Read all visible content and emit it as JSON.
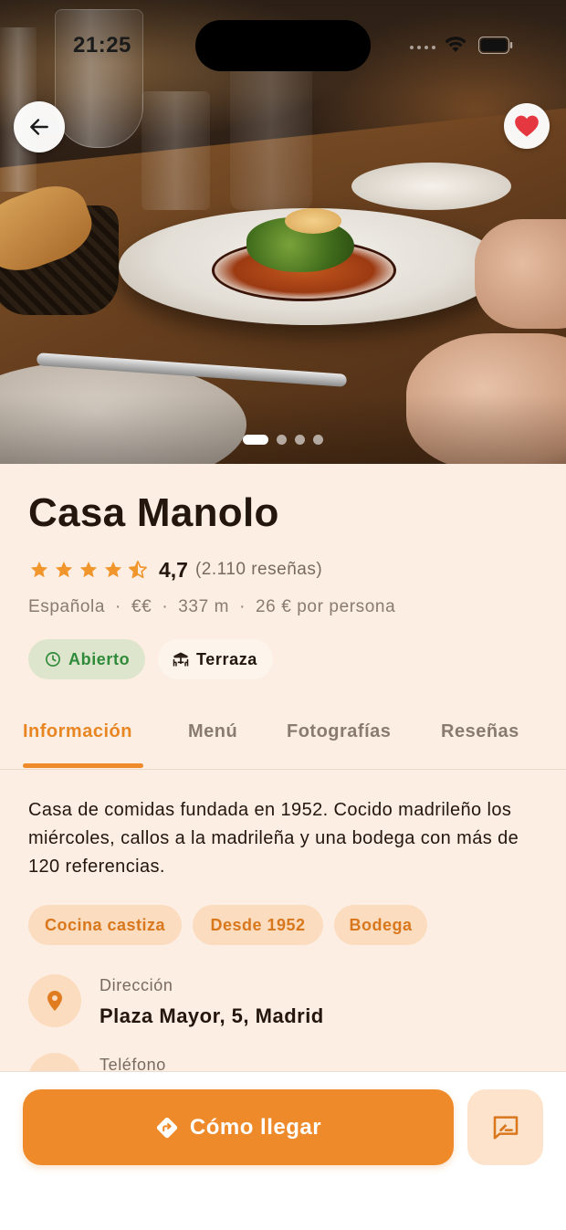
{
  "status_bar": {
    "time": "21:25"
  },
  "restaurant": {
    "name": "Casa Manolo",
    "rating": "4,7",
    "rating_stars": 4.5,
    "reviews_count": "(2.110 reseñas)",
    "cuisine": "Española",
    "price_level": "€€",
    "distance": "337 m",
    "price_per_person": "26 € por persona",
    "meta_separator": "·"
  },
  "gallery": {
    "total_images": 4,
    "current_index": 1
  },
  "chips": {
    "open": {
      "label": "Abierto",
      "icon": "clock-icon",
      "color": "#2f8a3a"
    },
    "terrace": {
      "label": "Terraza",
      "icon": "terrace-icon"
    }
  },
  "tabs": [
    {
      "label": "Información",
      "active": true
    },
    {
      "label": "Menú",
      "active": false
    },
    {
      "label": "Fotografías",
      "active": false
    },
    {
      "label": "Reseñas",
      "active": false
    }
  ],
  "info": {
    "description": "Casa de comidas fundada en 1952. Cocido madrileño los miércoles, callos a la madrileña y una bodega con más de 120 referencias.",
    "tags": [
      "Cocina castiza",
      "Desde 1952",
      "Bodega"
    ],
    "address_label": "Dirección",
    "address_value": "Plaza Mayor, 5, Madrid",
    "phone_label": "Teléfono"
  },
  "actions": {
    "directions_label": "Cómo llegar",
    "directions_icon": "directions-icon",
    "review_icon": "write-review-icon"
  },
  "colors": {
    "accent": "#ee8a2a",
    "accent_text": "#e88623",
    "background": "#fdeee3",
    "favorite": "#e5373f",
    "star": "#f0962d"
  }
}
